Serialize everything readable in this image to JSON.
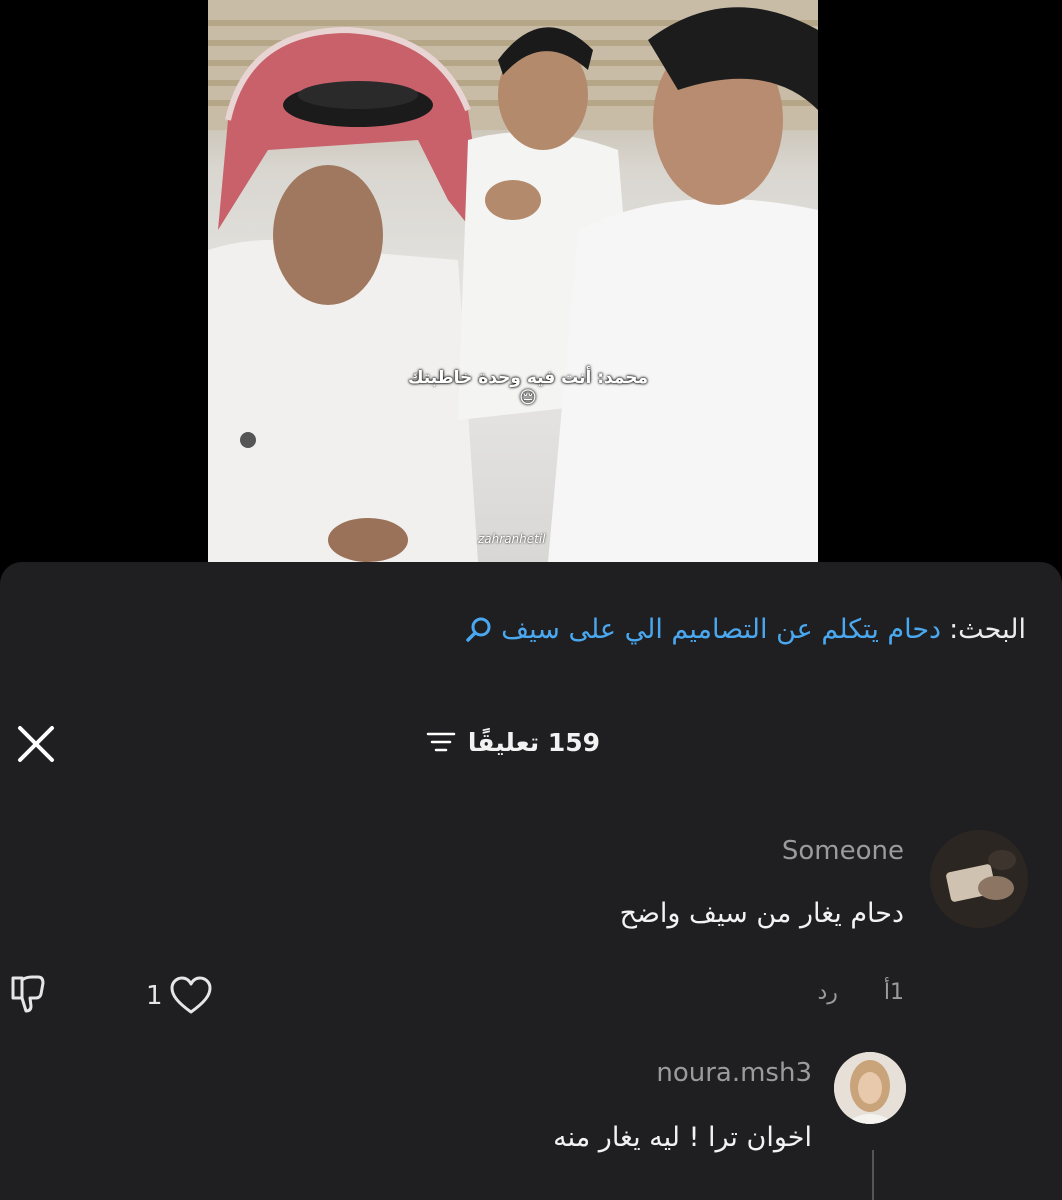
{
  "video": {
    "caption": "محمد: أنت فيه وحدة خاطبتك 😔",
    "watermark": "zahranhetil"
  },
  "search": {
    "prefix": "البحث:",
    "query": "دحام يتكلم عن التصاميم الي على سيف",
    "icon": "search-icon"
  },
  "comments_header": {
    "count_label": "159 تعليقًا",
    "sort_icon": "sort-filter-icon",
    "close_icon": "close-icon"
  },
  "comments": [
    {
      "username": "Someone",
      "text": "دحام يغار من سيف واضح",
      "time": "1أ",
      "reply_label": "رد",
      "likes": "1"
    },
    {
      "username": "noura.msh3",
      "text": "اخوان ترا ! ليه يغار منه"
    }
  ],
  "colors": {
    "sheet_bg": "#1f1f21",
    "link": "#4aa8f0",
    "muted": "#9b9b9b"
  }
}
